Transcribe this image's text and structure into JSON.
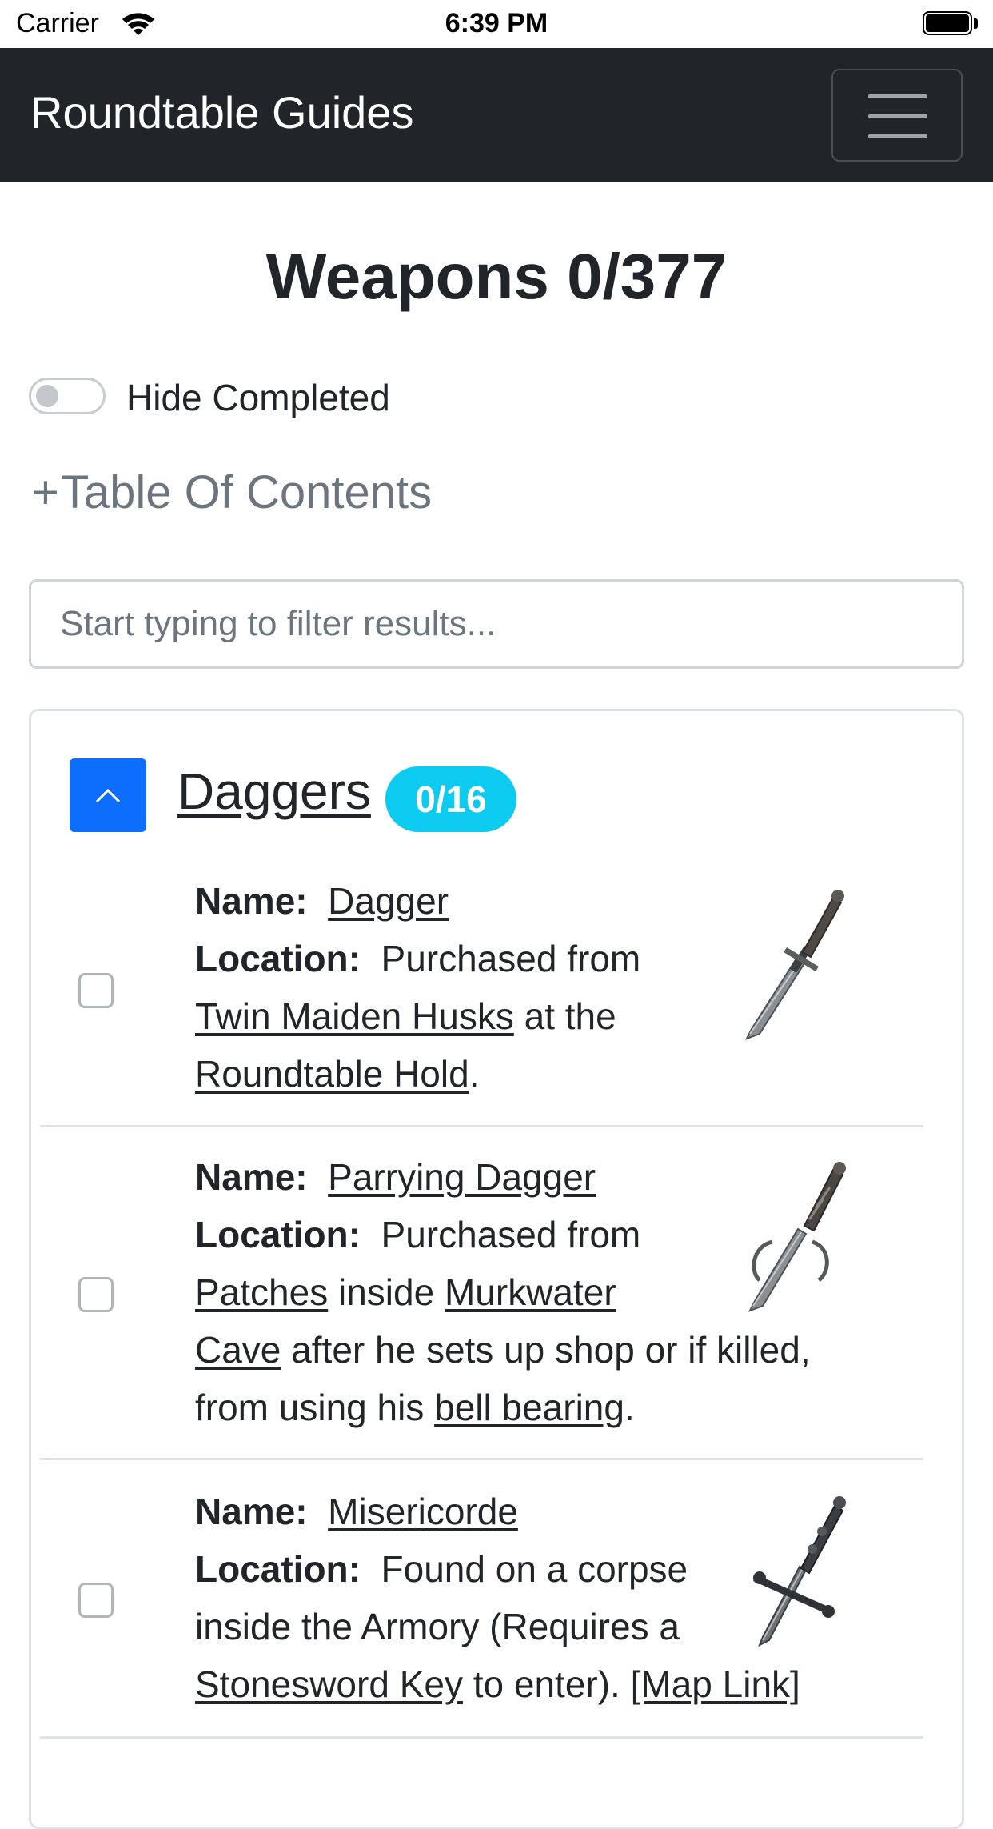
{
  "status_bar": {
    "carrier": "Carrier",
    "time": "6:39 PM"
  },
  "navbar": {
    "brand": "Roundtable Guides"
  },
  "page": {
    "title": "Weapons 0/377",
    "hide_completed_label": "Hide Completed",
    "hide_completed_on": false,
    "toc_plus": "+",
    "toc_label": "Table Of Contents",
    "filter_placeholder": "Start typing to filter results..."
  },
  "section": {
    "title": "Daggers",
    "badge": "0/16",
    "items": [
      {
        "name_label": "Name:",
        "name": "Dagger",
        "location_label": "Location:",
        "loc_1": "Purchased from",
        "link_1": "Twin Maiden Husks",
        "loc_2": "at the",
        "link_2": "Roundtable Hold",
        "loc_3": "."
      },
      {
        "name_label": "Name:",
        "name": "Parrying Dagger",
        "location_label": "Location:",
        "loc_1": "Purchased from",
        "link_1": "Patches",
        "loc_2": "inside",
        "link_2": "Murkwater",
        "link_2b": "Cave",
        "loc_3": "after he sets up shop or if killed,",
        "loc_4": "from using his",
        "link_3": "bell bearing",
        "loc_5": "."
      },
      {
        "name_label": "Name:",
        "name": "Misericorde",
        "location_label": "Location:",
        "loc_1": "Found on a corpse",
        "loc_2": "inside the Armory (Requires a",
        "link_1": "Stonesword Key",
        "loc_3": "to enter).",
        "link_2": "[Map Link]"
      }
    ]
  }
}
